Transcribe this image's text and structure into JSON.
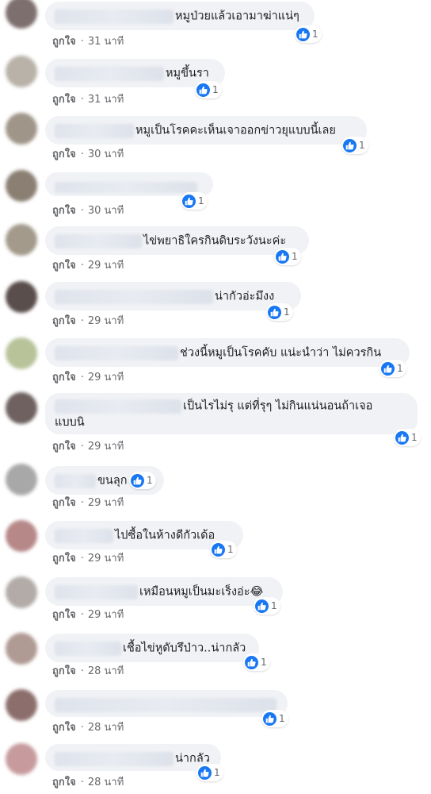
{
  "comments": [
    {
      "text": "หมูป่วยแล้วเอามาฆ่าแน่ๆ",
      "like_label": "ถูกใจ",
      "time": "31 นาที",
      "reactions": "1",
      "avatar_color": "#7d6f6e"
    },
    {
      "text": "หมูขึ้นรา",
      "like_label": "ถูกใจ",
      "time": "31 นาที",
      "reactions": "1",
      "avatar_color": "#b9b2a8"
    },
    {
      "text": "หมูเป็นโรคคะเห็นเจาออกข่าวยุแบบนี้เลย",
      "like_label": "ถูกใจ",
      "time": "30 นาที",
      "reactions": "1",
      "avatar_color": "#a09589"
    },
    {
      "text": "",
      "like_label": "ถูกใจ",
      "time": "30 นาที",
      "reactions": "1",
      "avatar_color": "#8a7f72"
    },
    {
      "text": "ไข่พยาธิใครกินดิบระวังนะค่ะ",
      "like_label": "ถูกใจ",
      "time": "29 นาที",
      "reactions": "1",
      "avatar_color": "#a39a8c"
    },
    {
      "text": "น่ากัวอ่ะมึงง",
      "like_label": "ถูกใจ",
      "time": "29 นาที",
      "reactions": "1",
      "avatar_color": "#5a4e4c"
    },
    {
      "text": "ช่วงนี้หมูเป็นโรคคับ แน่ะนำว่า ไม่ควรกิน",
      "like_label": "ถูกใจ",
      "time": "29 นาที",
      "reactions": "1",
      "avatar_color": "#b8c39a"
    },
    {
      "text": "เป็นไรไม่รุ แต่ที่รุๆ ไม่กินแน่นอนถ้าเจอ",
      "text2": "แบบนิ",
      "like_label": "ถูกใจ",
      "time": "29 นาที",
      "reactions": "1",
      "avatar_color": "#6e6160"
    },
    {
      "text": "ขนลุก",
      "like_label": "ถูกใจ",
      "time": "29 นาที",
      "reactions": "1",
      "avatar_color": "#a8a8a8"
    },
    {
      "text": "ไปซื้อในห้างดีกัวเด้อ",
      "like_label": "ถูกใจ",
      "time": "29 นาที",
      "reactions": "1",
      "avatar_color": "#b78888"
    },
    {
      "text": "เหมือนหมูเป็นมะเร็งอ่ะ😂",
      "like_label": "ถูกใจ",
      "time": "29 นาที",
      "reactions": "1",
      "avatar_color": "#b2aba8"
    },
    {
      "text": "เชื้อไข่หูดับรึป่าว..น่ากลัว",
      "like_label": "ถูกใจ",
      "time": "28 นาที",
      "reactions": "1",
      "avatar_color": "#b09a94"
    },
    {
      "text": "",
      "like_label": "ถูกใจ",
      "time": "28 นาที",
      "reactions": "1",
      "avatar_color": "#8c6f6c"
    },
    {
      "text": "น่ากลัว",
      "like_label": "ถูกใจ",
      "time": "28 นาที",
      "reactions": "1",
      "avatar_color": "#c79b9d"
    }
  ]
}
